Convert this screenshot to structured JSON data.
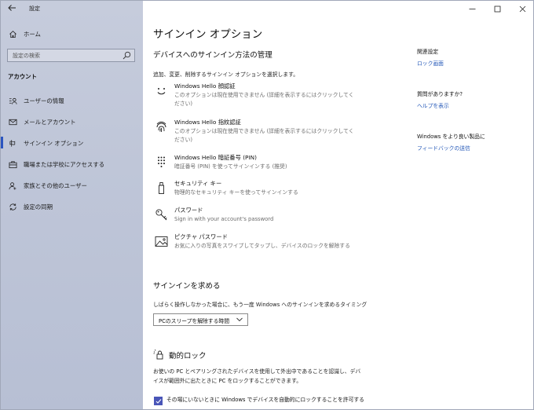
{
  "window": {
    "app_title": "設定",
    "back_icon": "back-arrow-icon",
    "controls": {
      "minimize": "—",
      "maximize": "☐",
      "close": "✕"
    }
  },
  "sidebar": {
    "home_label": "ホーム",
    "search_placeholder": "設定の検索",
    "section": "アカウント",
    "items": [
      {
        "label": "ユーザーの情報",
        "icon": "user-info-icon"
      },
      {
        "label": "メールとアカウント",
        "icon": "mail-icon"
      },
      {
        "label": "サインイン オプション",
        "icon": "key-icon",
        "active": true
      },
      {
        "label": "職場または学校にアクセスする",
        "icon": "briefcase-icon"
      },
      {
        "label": "家族とその他のユーザー",
        "icon": "person-add-icon"
      },
      {
        "label": "設定の同期",
        "icon": "sync-icon"
      }
    ]
  },
  "main": {
    "title": "サインイン オプション",
    "subtitle": "デバイスへのサインイン方法の管理",
    "description": "追加、変更、削除するサインイン オプションを選択します。",
    "options": [
      {
        "title": "Windows Hello 顔認証",
        "desc": "このオプションは現在使用できません (詳細を表示するにはクリックしてください)",
        "icon": "face-icon"
      },
      {
        "title": "Windows Hello 指紋認証",
        "desc": "このオプションは現在使用できません (詳細を表示するにはクリックしてください)",
        "icon": "fingerprint-icon"
      },
      {
        "title": "Windows Hello 暗証番号 (PIN)",
        "desc": "暗証番号 (PIN) を使ってサインインする (推奨)",
        "icon": "pin-keypad-icon"
      },
      {
        "title": "セキュリティ キー",
        "desc": "物理的なセキュリティ キーを使ってサインインする",
        "icon": "usb-key-icon"
      },
      {
        "title": "パスワード",
        "desc": "Sign in with your account's password",
        "icon": "password-key-icon"
      },
      {
        "title": "ピクチャ パスワード",
        "desc": "お気に入りの写真をスワイプしてタップし、デバイスのロックを解除する",
        "icon": "picture-icon"
      }
    ],
    "require_signin": {
      "heading": "サインインを求める",
      "label": "しばらく操作しなかった場合に、もう一度 Windows へのサインインを求めるタイミング",
      "dropdown_value": "PCのスリープを解除する時間"
    },
    "dynamic_lock": {
      "heading": "動的ロック",
      "text": "お使いの PC とペアリングされたデバイスを使用して外出中であることを認識し、デバイスが範囲外に出たときに PC をロックすることができます。",
      "checkbox_label": "その場にいないときに Windows でデバイスを自動的にロックすることを許可する",
      "checked": true
    }
  },
  "related": {
    "related_heading": "関連設定",
    "related_link": "ロック画面",
    "question_heading": "質問がありますか?",
    "question_link": "ヘルプを表示",
    "improve_heading": "Windows をより良い製品に",
    "improve_link": "フィードバックの送信"
  },
  "colors": {
    "accent": "#4a56b8",
    "link": "#2458b8",
    "sidebar": "#c0c7d9"
  }
}
